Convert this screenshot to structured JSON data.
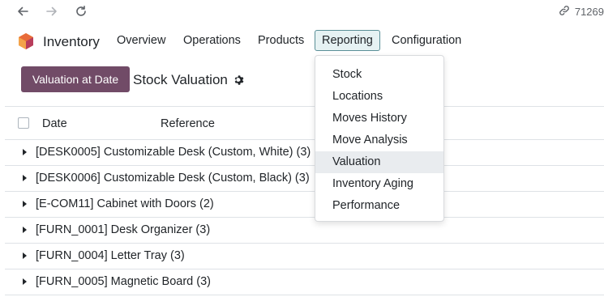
{
  "browser": {
    "url_text": "71269"
  },
  "navbar": {
    "app_name": "Inventory",
    "menu": [
      "Overview",
      "Operations",
      "Products",
      "Reporting",
      "Configuration"
    ]
  },
  "control_panel": {
    "primary_button": "Valuation at Date",
    "title": "Stock Valuation"
  },
  "list": {
    "columns": [
      "Date",
      "Reference"
    ],
    "groups": [
      "[DESK0005] Customizable Desk (Custom, White) (3)",
      "[DESK0006] Customizable Desk (Custom, Black) (3)",
      "[E-COM11] Cabinet with Doors (2)",
      "[FURN_0001] Desk Organizer (3)",
      "[FURN_0004] Letter Tray (3)",
      "[FURN_0005] Magnetic Board (3)"
    ]
  },
  "reporting_menu": {
    "items": [
      "Stock",
      "Locations",
      "Moves History",
      "Move Analysis",
      "Valuation",
      "Inventory Aging",
      "Performance"
    ],
    "highlighted": "Valuation"
  },
  "colors": {
    "primary": "#714b67",
    "active_menu_border": "#5a8f97",
    "active_menu_bg": "#e6f2f3"
  }
}
